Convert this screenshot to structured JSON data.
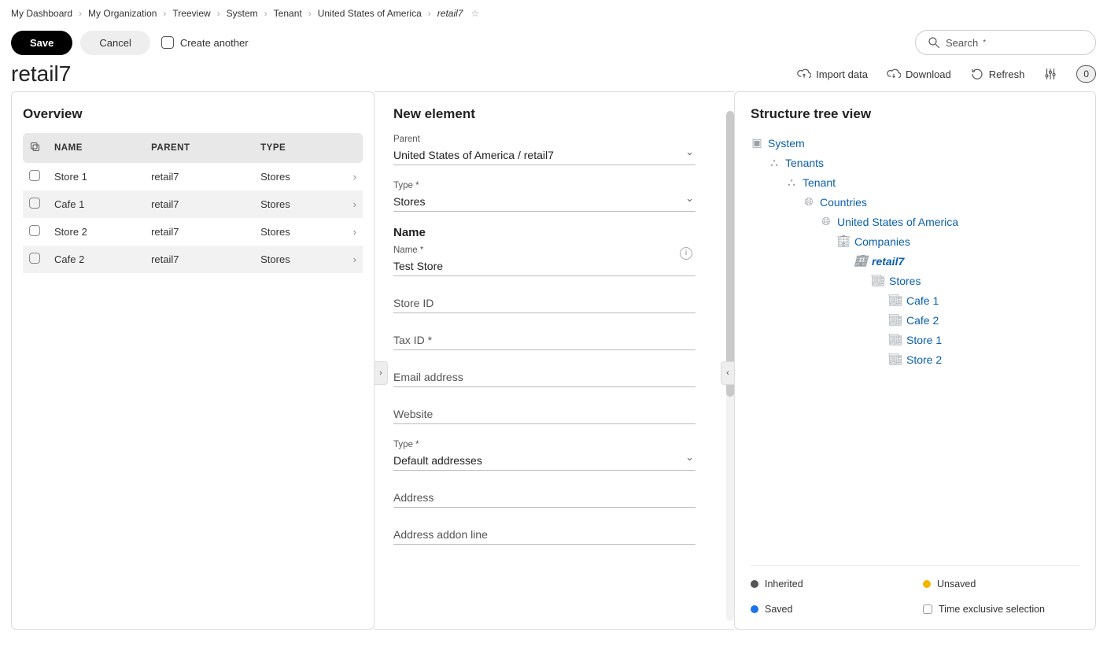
{
  "breadcrumb": [
    "My Dashboard",
    "My Organization",
    "Treeview",
    "System",
    "Tenant",
    "United States of America",
    "retail7"
  ],
  "actions": {
    "save": "Save",
    "cancel": "Cancel",
    "create_another": "Create another"
  },
  "search": {
    "placeholder": "Search"
  },
  "page_title": "retail7",
  "tools": {
    "import": "Import data",
    "download": "Download",
    "refresh": "Refresh",
    "badge": "0"
  },
  "overview": {
    "title": "Overview",
    "columns": {
      "name": "NAME",
      "parent": "PARENT",
      "type": "TYPE"
    },
    "rows": [
      {
        "name": "Store 1",
        "parent": "retail7",
        "type": "Stores"
      },
      {
        "name": "Cafe 1",
        "parent": "retail7",
        "type": "Stores"
      },
      {
        "name": "Store 2",
        "parent": "retail7",
        "type": "Stores"
      },
      {
        "name": "Cafe 2",
        "parent": "retail7",
        "type": "Stores"
      }
    ]
  },
  "form": {
    "title": "New element",
    "parent": {
      "label": "Parent",
      "value": "United States of America / retail7"
    },
    "type": {
      "label": "Type *",
      "value": "Stores"
    },
    "name_section": "Name",
    "name": {
      "label": "Name *",
      "value": "Test Store"
    },
    "store_id": {
      "placeholder": "Store ID"
    },
    "tax_id": {
      "placeholder": "Tax ID *"
    },
    "email": {
      "placeholder": "Email address"
    },
    "website": {
      "placeholder": "Website"
    },
    "addrtype": {
      "label": "Type *",
      "value": "Default addresses"
    },
    "address": {
      "placeholder": "Address"
    },
    "addon": {
      "placeholder": "Address addon line"
    }
  },
  "tree": {
    "title": "Structure tree view",
    "nodes": [
      {
        "label": "System",
        "level": 0
      },
      {
        "label": "Tenants",
        "level": 1
      },
      {
        "label": "Tenant",
        "level": 2
      },
      {
        "label": "Countries",
        "level": 3
      },
      {
        "label": "United States of America",
        "level": 4
      },
      {
        "label": "Companies",
        "level": 5
      },
      {
        "label": "retail7",
        "level": 6,
        "current": true
      },
      {
        "label": "Stores",
        "level": 7
      },
      {
        "label": "Cafe 1",
        "level": 8
      },
      {
        "label": "Cafe 2",
        "level": 8
      },
      {
        "label": "Store 1",
        "level": 8
      },
      {
        "label": "Store 2",
        "level": 8
      }
    ]
  },
  "legend": {
    "inherited": "Inherited",
    "unsaved": "Unsaved",
    "saved": "Saved",
    "timeexcl": "Time exclusive selection"
  }
}
